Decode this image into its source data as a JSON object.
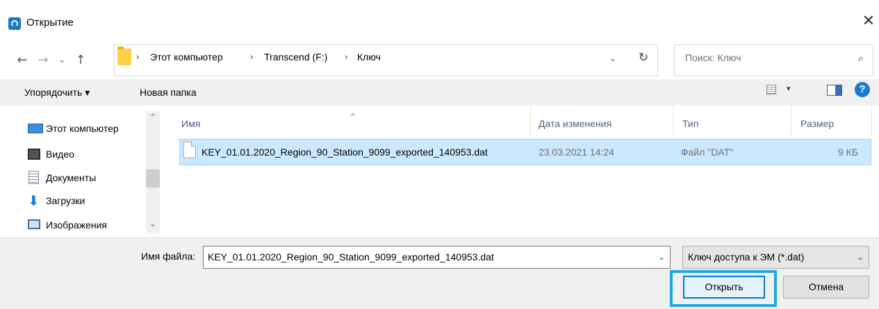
{
  "window": {
    "title": "Открытие",
    "close_glyph": "✕"
  },
  "nav": {
    "back": "←",
    "forward": "→",
    "recent": "⌄",
    "up": "↑"
  },
  "address": {
    "breadcrumb": [
      "Этот компьютер",
      "Transcend (F:)",
      "Ключ"
    ],
    "separator": "›",
    "dropdown": "⌄",
    "refresh": "↻"
  },
  "search": {
    "placeholder": "Поиск: Ключ",
    "icon": "⌕"
  },
  "commandbar": {
    "organize": "Упорядочить ▾",
    "new_folder": "Новая папка",
    "view_dropdown": "▾",
    "help": "?"
  },
  "sidebar": {
    "items": [
      {
        "label": "Этот компьютер",
        "icon": "computer-icon"
      },
      {
        "label": "Видео",
        "icon": "video-icon"
      },
      {
        "label": "Документы",
        "icon": "documents-icon"
      },
      {
        "label": "Загрузки",
        "icon": "downloads-icon"
      },
      {
        "label": "Изображения",
        "icon": "pictures-icon"
      }
    ],
    "scroll_up": "⌃",
    "scroll_down": "⌄"
  },
  "filelist": {
    "sort_arrow": "^",
    "columns": [
      "Имя",
      "Дата изменения",
      "Тип",
      "Размер"
    ],
    "rows": [
      {
        "name": "KEY_01.01.2020_Region_90_Station_9099_exported_140953.dat",
        "modified": "23.03.2021 14:24",
        "type": "Файл \"DAT\"",
        "size": "9 КБ",
        "selected": true
      }
    ]
  },
  "footer": {
    "filename_label": "Имя файла:",
    "filename_value": "KEY_01.01.2020_Region_90_Station_9099_exported_140953.dat",
    "dropdown": "⌄",
    "filetype": "Ключ доступа к ЭМ (*.dat)",
    "open_button": "Открыть",
    "cancel_button": "Отмена"
  },
  "colors": {
    "accent": "#0078d7",
    "selection": "#cce8ff",
    "highlight": "#1ea7e8"
  }
}
